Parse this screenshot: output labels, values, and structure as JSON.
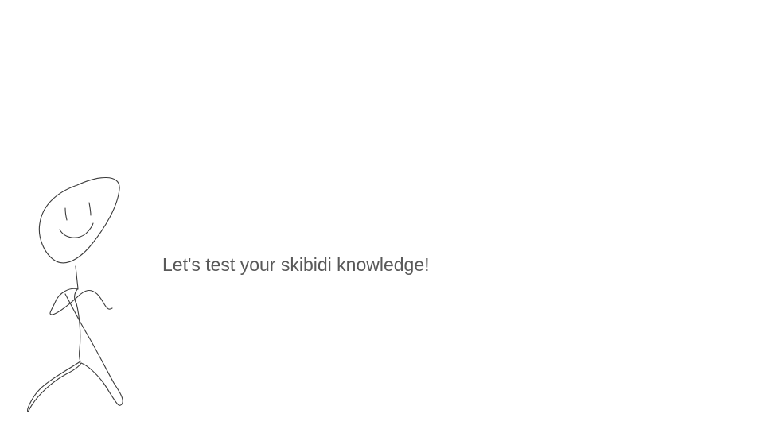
{
  "slide": {
    "text": "Let's test your skibidi knowledge!",
    "drawing": "stick-figure-sketch",
    "text_color": "#595959",
    "stroke_color": "#3a3a3a",
    "background": "#ffffff"
  }
}
